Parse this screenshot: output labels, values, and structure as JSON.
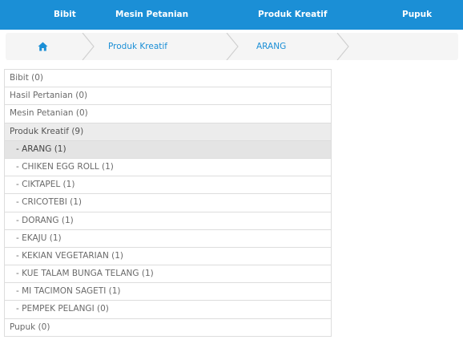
{
  "nav": {
    "items": [
      "Bibit",
      "Mesin Petanian",
      "Produk Kreatif",
      "Pupuk"
    ]
  },
  "breadcrumb": {
    "items": [
      "Produk Kreatif",
      "ARANG"
    ]
  },
  "categories": {
    "items": [
      {
        "label": "Bibit (0)"
      },
      {
        "label": "Hasil Pertanian (0)"
      },
      {
        "label": "Mesin Petanian (0)"
      },
      {
        "label": "Produk Kreatif (9)"
      },
      {
        "label": "- ARANG (1)"
      },
      {
        "label": "- CHIKEN EGG ROLL (1)"
      },
      {
        "label": "- CIKTAPEL (1)"
      },
      {
        "label": "- CRICOTEBI (1)"
      },
      {
        "label": "- DORANG (1)"
      },
      {
        "label": "- EKAJU (1)"
      },
      {
        "label": "- KEKIAN VEGETARIAN (1)"
      },
      {
        "label": "- KUE TALAM BUNGA TELANG (1)"
      },
      {
        "label": "- MI TACIMON SAGETI (1)"
      },
      {
        "label": "- PEMPEK PELANGI (0)"
      },
      {
        "label": "Pupuk (0)"
      }
    ]
  },
  "colors": {
    "navbar": "#1b8fd6",
    "link": "#1b8fd6",
    "active_parent": "#ececec",
    "active_child": "#e4e4e4"
  }
}
